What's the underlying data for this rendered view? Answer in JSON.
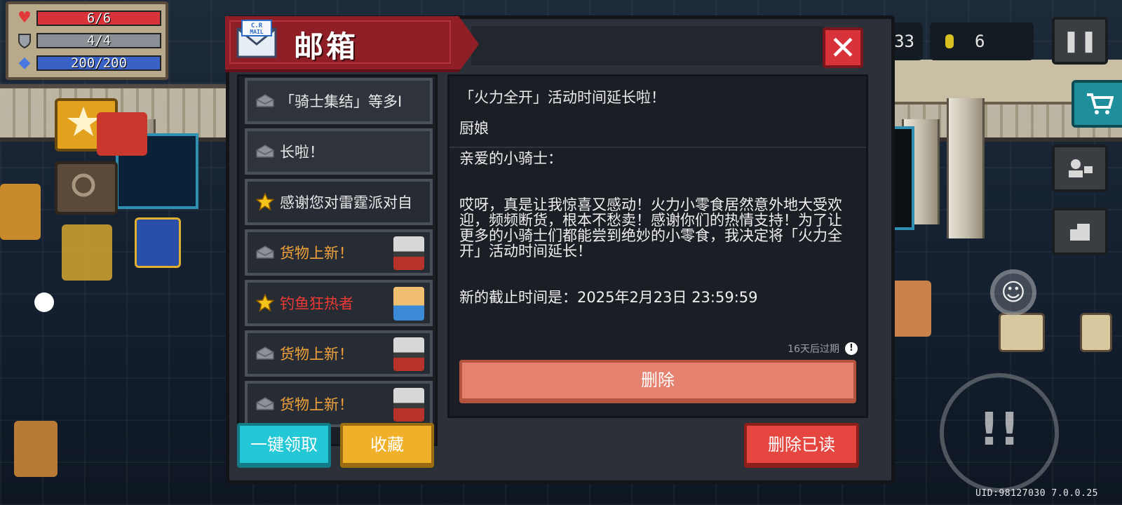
{
  "hud": {
    "health": {
      "text": "6/6",
      "fill": 1.0,
      "color": "#d8323a"
    },
    "armor": {
      "text": "4/4",
      "fill": 1.0,
      "color": "#8a8f96"
    },
    "energy": {
      "text": "200/200",
      "fill": 1.0,
      "color": "#3a62c6"
    },
    "gems": "33",
    "coins": "6",
    "uid": "UID:98127030 7.0.0.25"
  },
  "mailbox": {
    "title": "邮箱",
    "icon_text": "C.R\nMAIL",
    "close_label": "✕",
    "items": [
      {
        "icon": "envelope-icon",
        "label": "「骑士集结」等多I",
        "style": "normal",
        "avatar": false
      },
      {
        "icon": "envelope-icon",
        "label": "长啦！",
        "style": "normal",
        "avatar": false
      },
      {
        "icon": "star-icon",
        "label": "感谢您对雷霆派对自",
        "style": "normal",
        "avatar": false
      },
      {
        "icon": "envelope-icon",
        "label": "货物上新！",
        "style": "orange",
        "avatar": true
      },
      {
        "icon": "star-icon",
        "label": "钓鱼狂热者",
        "style": "red",
        "avatar": true
      },
      {
        "icon": "envelope-icon",
        "label": "货物上新！",
        "style": "orange",
        "avatar": true
      },
      {
        "icon": "envelope-icon",
        "label": "货物上新！",
        "style": "orange",
        "avatar": true
      }
    ],
    "message": {
      "title": "「火力全开」活动时间延长啦！",
      "sender": "厨娘",
      "greeting": "亲爱的小骑士：",
      "body": "哎呀，真是让我惊喜又感动！火力小零食居然意外地大受欢迎，频频断货，根本不愁卖！感谢你们的热情支持！为了让更多的小骑士们都能尝到绝妙的小零食，我决定将「火力全开」活动时间延长！",
      "deadline": "新的截止时间是：2025年2月23日 23:59:59",
      "expire_text": "16天后过期",
      "expire_icon": "!"
    },
    "delete_label": "删除",
    "claim_all_label": "一键领取",
    "favorite_label": "收藏",
    "delete_read_label": "删除已读"
  },
  "colors": {
    "ribbon": "#8f1e26",
    "claim": "#24c7d6",
    "favorite": "#f0b02a",
    "delete_read": "#e5463f",
    "delete": "#e5826f",
    "orange_text": "#f0a23a",
    "red_text": "#ee3a35"
  }
}
